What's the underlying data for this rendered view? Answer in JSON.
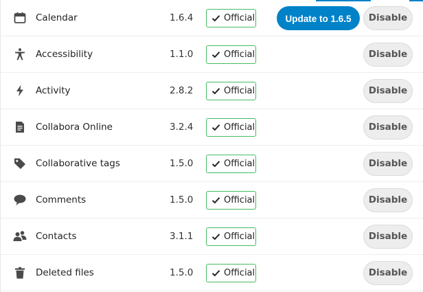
{
  "colors": {
    "primary": "#0082c9",
    "official_border": "#46ba61",
    "icon": "#4a4a4a",
    "disable_bg": "#ededed"
  },
  "apps": [
    {
      "name": "Calendar",
      "version": "1.6.4",
      "badge": "Official",
      "icon": "calendar-icon",
      "update_label": "Update to 1.6.5",
      "disable_label": "Disable"
    },
    {
      "name": "Accessibility",
      "version": "1.1.0",
      "badge": "Official",
      "icon": "accessibility-icon",
      "update_label": null,
      "disable_label": "Disable"
    },
    {
      "name": "Activity",
      "version": "2.8.2",
      "badge": "Official",
      "icon": "activity-icon",
      "update_label": null,
      "disable_label": "Disable"
    },
    {
      "name": "Collabora Online",
      "version": "3.2.4",
      "badge": "Official",
      "icon": "document-icon",
      "update_label": null,
      "disable_label": "Disable"
    },
    {
      "name": "Collaborative tags",
      "version": "1.5.0",
      "badge": "Official",
      "icon": "tag-icon",
      "update_label": null,
      "disable_label": "Disable"
    },
    {
      "name": "Comments",
      "version": "1.5.0",
      "badge": "Official",
      "icon": "comment-icon",
      "update_label": null,
      "disable_label": "Disable"
    },
    {
      "name": "Contacts",
      "version": "3.1.1",
      "badge": "Official",
      "icon": "contacts-icon",
      "update_label": null,
      "disable_label": "Disable"
    },
    {
      "name": "Deleted files",
      "version": "1.5.0",
      "badge": "Official",
      "icon": "trash-icon",
      "update_label": null,
      "disable_label": "Disable"
    }
  ]
}
